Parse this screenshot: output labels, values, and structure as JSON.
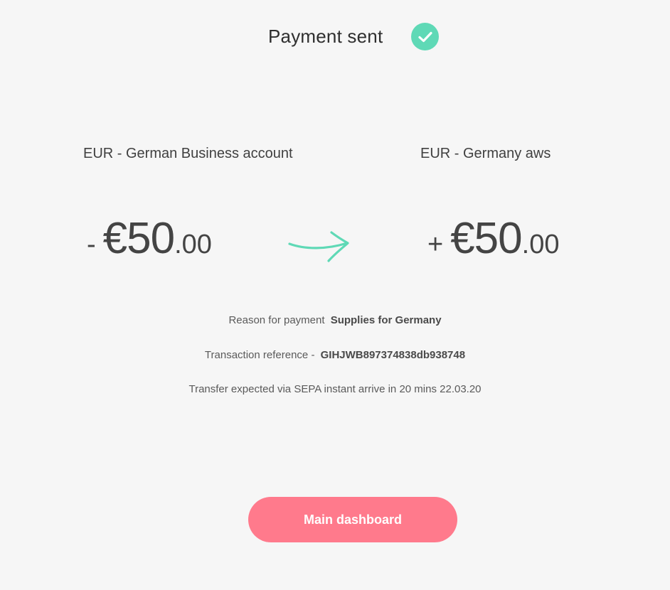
{
  "header": {
    "title": "Payment sent",
    "status_icon": "check-icon",
    "accent_color": "#5fd9b6"
  },
  "from": {
    "account": "EUR - German Business account",
    "sign": "-",
    "amount_major": "€50",
    "amount_minor": ".00"
  },
  "to": {
    "account": "EUR - Germany aws",
    "sign": "+",
    "amount_major": "€50",
    "amount_minor": ".00"
  },
  "transfer_icon": "arrow-right-icon",
  "details": {
    "reason_label": "Reason for payment",
    "reason_value": "Supplies for Germany",
    "reference_label": "Transaction reference -",
    "reference_value": "GIHJWB897374838db938748",
    "transfer_text": "Transfer expected via SEPA instant arrive in 20 mins 22.03.20"
  },
  "actions": {
    "dashboard_label": "Main dashboard",
    "button_color": "#ff7a8c"
  }
}
